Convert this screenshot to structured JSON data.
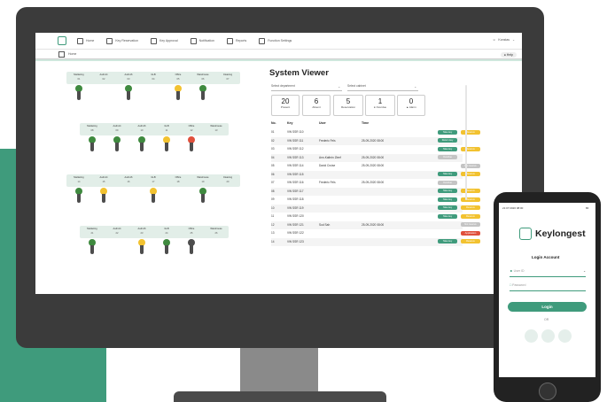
{
  "nav": {
    "items": [
      "Home",
      "Key Reservation",
      "Key Approval",
      "Notification",
      "Reports",
      "Function Settings"
    ],
    "user": "Konstas"
  },
  "subbar": {
    "crumb": "Home",
    "help": "Help"
  },
  "cabinets": [
    {
      "labels": [
        "Marketing",
        "Audi A4",
        "Audi A6",
        "GLB",
        "Office",
        "Warehouse",
        "Cleaning"
      ],
      "nums": [
        "01",
        "02",
        "03",
        "04",
        "05",
        "06",
        "07"
      ],
      "keys": [
        "green",
        "",
        "green",
        "",
        "yellow",
        "green",
        ""
      ]
    },
    {
      "labels": [
        "Marketing",
        "Audi A4",
        "Audi A6",
        "GLB",
        "Office",
        "Warehouse"
      ],
      "nums": [
        "08",
        "09",
        "10",
        "11",
        "12",
        "13"
      ],
      "keys": [
        "green",
        "green",
        "green",
        "yellow",
        "red",
        ""
      ]
    },
    {
      "labels": [
        "Marketing",
        "Audi A4",
        "Audi A6",
        "GLB",
        "Office",
        "Warehouse",
        "Cleaning"
      ],
      "nums": [
        "14",
        "15",
        "16",
        "17",
        "18",
        "19",
        "20"
      ],
      "keys": [
        "green",
        "yellow",
        "",
        "yellow",
        "",
        "green",
        ""
      ]
    },
    {
      "labels": [
        "Marketing",
        "Audi A4",
        "Audi A6",
        "GLB",
        "Office",
        "Warehouse"
      ],
      "nums": [
        "21",
        "22",
        "23",
        "24",
        "25",
        "26"
      ],
      "keys": [
        "green",
        "",
        "yellow",
        "green",
        "dark",
        ""
      ]
    }
  ],
  "viewer": {
    "title": "System Viewer",
    "select_department": "Select department",
    "select_cabinet": "Select cabinet",
    "stats": [
      {
        "num": "20",
        "label": "Present"
      },
      {
        "num": "6",
        "label": "Absent"
      },
      {
        "num": "5",
        "label": "Reservation"
      },
      {
        "num": "1",
        "label": "● Overdue"
      },
      {
        "num": "0",
        "label": "▲ Alarm"
      }
    ],
    "columns": [
      "No.",
      "Key",
      "User",
      "Time"
    ],
    "rows": [
      {
        "no": "01",
        "key": "VW SSR 110",
        "user": "",
        "time": "",
        "b1": "Take key",
        "b2": "Reserve",
        "c1": "#3f9b7c",
        "c2": "#f2c230"
      },
      {
        "no": "02",
        "key": "VW SSR 111",
        "user": "Frederic Fels",
        "time": "25-09-2020 08:00",
        "b1": "Return key",
        "b2": "",
        "c1": "#3f9b7c",
        "c2": ""
      },
      {
        "no": "03",
        "key": "VW SSR 112",
        "user": "",
        "time": "",
        "b1": "Take key",
        "b2": "Reserve",
        "c1": "#3f9b7c",
        "c2": "#f2c230"
      },
      {
        "no": "04",
        "key": "VW SSR 113",
        "user": "Ann-Kathrin Zleef",
        "time": "25-09-2020 08:00",
        "b1": "Overdue",
        "b2": "",
        "c1": "#c4c4c4",
        "c2": ""
      },
      {
        "no": "05",
        "key": "VW SSR 114",
        "user": "David Cruise",
        "time": "25-09-2020 08:00",
        "b1": "",
        "b2": "Not reserve",
        "c1": "",
        "c2": "#c4c4c4"
      },
      {
        "no": "06",
        "key": "VW SSR 115",
        "user": "",
        "time": "",
        "b1": "Take key",
        "b2": "Reserve",
        "c1": "#3f9b7c",
        "c2": "#f2c230"
      },
      {
        "no": "07",
        "key": "VW SSR 116",
        "user": "Frederic Fels",
        "time": "25-09-2020 08:00",
        "b1": "Overdue",
        "b2": "",
        "c1": "#c4c4c4",
        "c2": ""
      },
      {
        "no": "08",
        "key": "VW SSR 117",
        "user": "",
        "time": "",
        "b1": "Take key",
        "b2": "Reserve",
        "c1": "#3f9b7c",
        "c2": "#f2c230"
      },
      {
        "no": "09",
        "key": "VW SSR 118",
        "user": "",
        "time": "",
        "b1": "Take key",
        "b2": "Reserve",
        "c1": "#3f9b7c",
        "c2": "#f2c230"
      },
      {
        "no": "10",
        "key": "VW SSR 119",
        "user": "",
        "time": "",
        "b1": "Take key",
        "b2": "Reserve",
        "c1": "#3f9b7c",
        "c2": "#f2c230"
      },
      {
        "no": "11",
        "key": "VW SSR 120",
        "user": "",
        "time": "",
        "b1": "Take key",
        "b2": "Reserve",
        "c1": "#3f9b7c",
        "c2": "#f2c230"
      },
      {
        "no": "12",
        "key": "VW SSR 121",
        "user": "Sud Sah",
        "time": "25-09-2020 08:00",
        "b1": "",
        "b2": "Not reserve",
        "c1": "",
        "c2": "#c4c4c4"
      },
      {
        "no": "13",
        "key": "VW SSR 122",
        "user": "",
        "time": "",
        "b1": "",
        "b2": "Application",
        "c1": "",
        "c2": "#e0503c"
      },
      {
        "no": "14",
        "key": "VW SSR 123",
        "user": "",
        "time": "",
        "b1": "Take key",
        "b2": "Reserve",
        "c1": "#3f9b7c",
        "c2": "#f2c230"
      }
    ]
  },
  "phone": {
    "time": "21:07:2020 08:00",
    "battery": "80",
    "brand": "Keylongest",
    "title": "Login Account",
    "user_placeholder": "User ID",
    "password_placeholder": "Password",
    "login": "Login",
    "or": "OR"
  },
  "colors": {
    "accent": "#3f9b7c",
    "reserve": "#f2c230",
    "alarm": "#e0503c",
    "muted": "#c4c4c4"
  }
}
